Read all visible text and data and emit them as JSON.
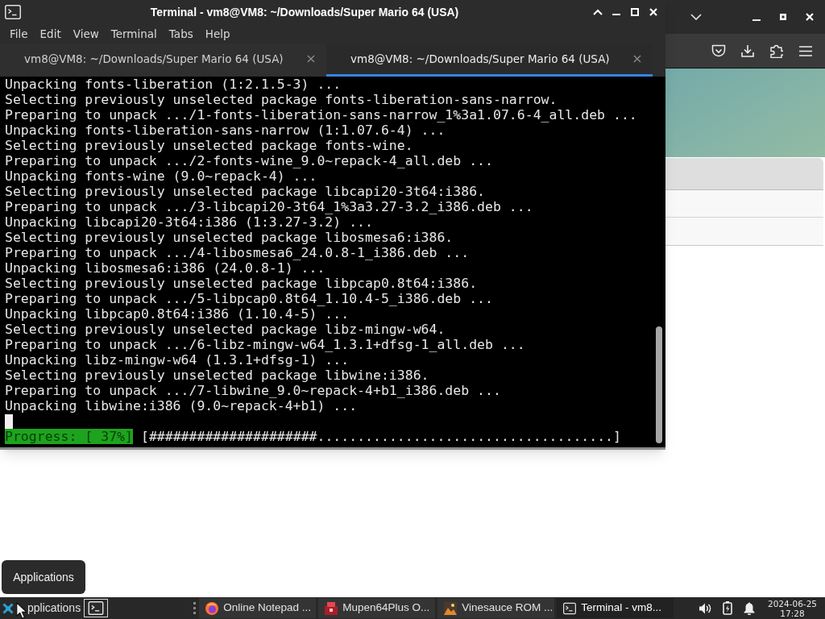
{
  "terminal_window": {
    "title": "Terminal - vm8@VM8: ~/Downloads/Super Mario 64 (USA)",
    "menu": [
      "File",
      "Edit",
      "View",
      "Terminal",
      "Tabs",
      "Help"
    ],
    "tabs": [
      {
        "label": "vm8@VM8: ~/Downloads/Super Mario 64 (USA)",
        "close": "×",
        "selected": false
      },
      {
        "label": "vm8@VM8: ~/Downloads/Super Mario 64 (USA)",
        "close": "×",
        "selected": true
      }
    ],
    "lines": [
      "Unpacking fonts-liberation (1:2.1.5-3) ...",
      "Selecting previously unselected package fonts-liberation-sans-narrow.",
      "Preparing to unpack .../1-fonts-liberation-sans-narrow_1%3a1.07.6-4_all.deb ...",
      "Unpacking fonts-liberation-sans-narrow (1:1.07.6-4) ...",
      "Selecting previously unselected package fonts-wine.",
      "Preparing to unpack .../2-fonts-wine_9.0~repack-4_all.deb ...",
      "Unpacking fonts-wine (9.0~repack-4) ...",
      "Selecting previously unselected package libcapi20-3t64:i386.",
      "Preparing to unpack .../3-libcapi20-3t64_1%3a3.27-3.2_i386.deb ...",
      "Unpacking libcapi20-3t64:i386 (1:3.27-3.2) ...",
      "Selecting previously unselected package libosmesa6:i386.",
      "Preparing to unpack .../4-libosmesa6_24.0.8-1_i386.deb ...",
      "Unpacking libosmesa6:i386 (24.0.8-1) ...",
      "Selecting previously unselected package libpcap0.8t64:i386.",
      "Preparing to unpack .../5-libpcap0.8t64_1.10.4-5_i386.deb ...",
      "Unpacking libpcap0.8t64:i386 (1.10.4-5) ...",
      "Selecting previously unselected package libz-mingw-w64.",
      "Preparing to unpack .../6-libz-mingw-w64_1.3.1+dfsg-1_all.deb ...",
      "Unpacking libz-mingw-w64 (1.3.1+dfsg-1) ...",
      "Selecting previously unselected package libwine:i386.",
      "Preparing to unpack .../7-libwine_9.0~repack-4+b1_i386.deb ...",
      "Unpacking libwine:i386 (9.0~repack-4+b1) ..."
    ],
    "progress": {
      "label": "Progress: [ 37%]",
      "bar": "[#####################.....................................]"
    }
  },
  "tooltip": {
    "text": "Applications"
  },
  "taskbar": {
    "menu_button": "pplications",
    "tasks": [
      {
        "kind": "browser",
        "label": "Online Notepad ...",
        "selected": false
      },
      {
        "kind": "emulator",
        "label": "Mupen64Plus O...",
        "selected": false
      },
      {
        "kind": "image",
        "label": "Vinesauce ROM ...",
        "selected": false
      },
      {
        "kind": "terminal",
        "label": "Terminal - vm8...",
        "selected": true
      }
    ],
    "clock": {
      "date": "2024-06-25",
      "time": "17:28"
    }
  }
}
